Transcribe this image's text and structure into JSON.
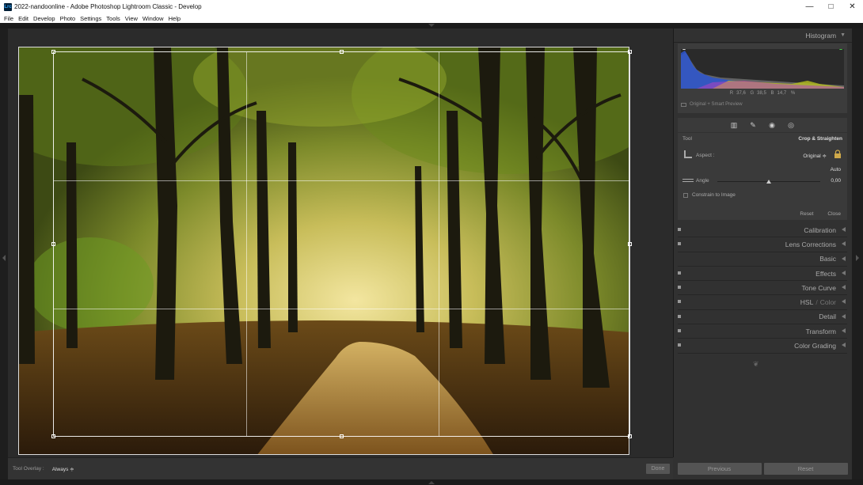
{
  "window": {
    "title": "2022-nandoonline - Adobe Photoshop Lightroom Classic - Develop",
    "app_icon_text": "Lrc",
    "controls": [
      "minimize-icon",
      "maximize-icon",
      "close-icon"
    ]
  },
  "menu": [
    "File",
    "Edit",
    "Develop",
    "Photo",
    "Settings",
    "Tools",
    "View",
    "Window",
    "Help"
  ],
  "toolbar": {
    "overlay_label": "Tool Overlay :",
    "overlay_value": "Always ≑",
    "done_label": "Done"
  },
  "histogram": {
    "title": "Histogram",
    "r_label": "R",
    "r_value": "37,6",
    "g_label": "G",
    "g_value": "38,5",
    "b_label": "B",
    "b_value": "14,7",
    "percent": "%",
    "preview_label": "Original + Smart Preview"
  },
  "crop": {
    "tool_label": "Tool",
    "tool_name": "Crop & Straighten",
    "aspect_label": "Aspect :",
    "aspect_value": "Original ≑",
    "auto_label": "Auto",
    "angle_label": "Angle",
    "angle_value": "0,00",
    "angle_slider_fraction": 0.5,
    "constrain_label": "Constrain to Image",
    "reset_label": "Reset",
    "close_label": "Close"
  },
  "panels": [
    {
      "label": "Calibration"
    },
    {
      "label": "Lens Corrections"
    },
    {
      "label": "Basic"
    },
    {
      "label": "Effects"
    },
    {
      "label": "Tone Curve"
    },
    {
      "label": "HSL",
      "sep": "/",
      "extra": "Color"
    },
    {
      "label": "Detail"
    },
    {
      "label": "Transform"
    },
    {
      "label": "Color Grading"
    }
  ],
  "bottom": {
    "previous_label": "Previous",
    "reset_label": "Reset"
  },
  "colors": {
    "panel_bg": "#313131",
    "workspace_bg": "#111111",
    "accent": "#31a8ff"
  }
}
